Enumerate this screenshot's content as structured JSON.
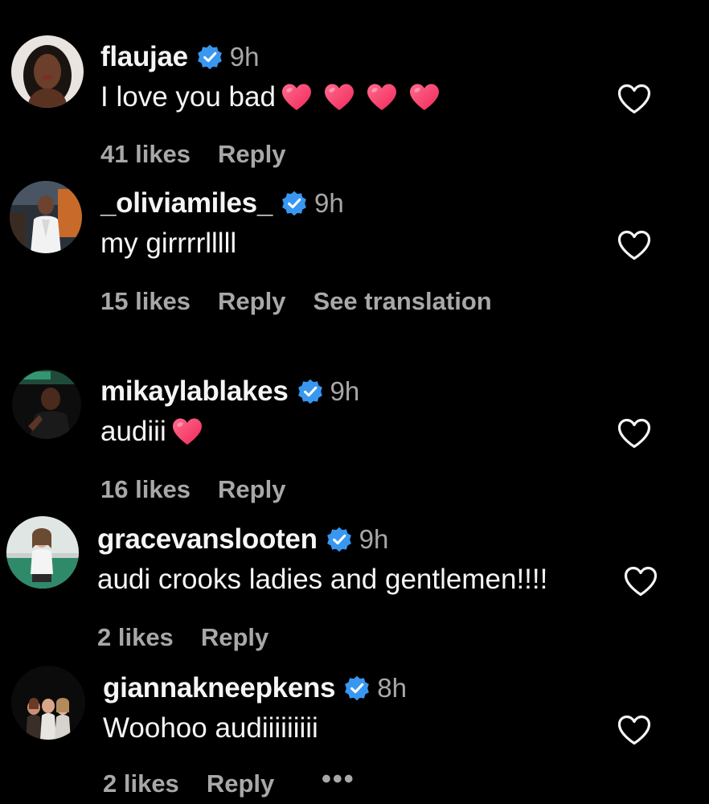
{
  "colors": {
    "background": "#000000",
    "text": "#f5f5f5",
    "muted": "#a8a8a8",
    "verified": "#3897f0",
    "emoji_heart": "#ff3366"
  },
  "comments": [
    {
      "username": "flaujae",
      "verified": true,
      "time": "9h",
      "text": "I love you bad",
      "emoji": [
        "heart-emoji",
        "heart-emoji",
        "heart-emoji",
        "heart-emoji"
      ],
      "likes": "41 likes",
      "reply": "Reply"
    },
    {
      "username": "_oliviamiles_",
      "verified": true,
      "time": "9h",
      "text": "my girrrrlllll",
      "likes": "15 likes",
      "reply": "Reply",
      "see_translation": "See translation"
    },
    {
      "username": "mikaylablakes",
      "verified": true,
      "time": "9h",
      "text": "audiii",
      "emoji": [
        "heart-emoji"
      ],
      "likes": "16 likes",
      "reply": "Reply"
    },
    {
      "username": "gracevanslooten",
      "verified": true,
      "time": "9h",
      "text": "audi crooks ladies and gentlemen!!!!",
      "likes": "2 likes",
      "reply": "Reply"
    },
    {
      "username": "giannakneepkens",
      "verified": true,
      "time": "8h",
      "text": "Woohoo audiiiiiiiii",
      "likes": "2 likes",
      "reply": "Reply",
      "more": "•••"
    }
  ],
  "icons": {
    "like": "heart-outline-icon",
    "verified": "verified-badge-icon",
    "more": "more-options-icon"
  }
}
